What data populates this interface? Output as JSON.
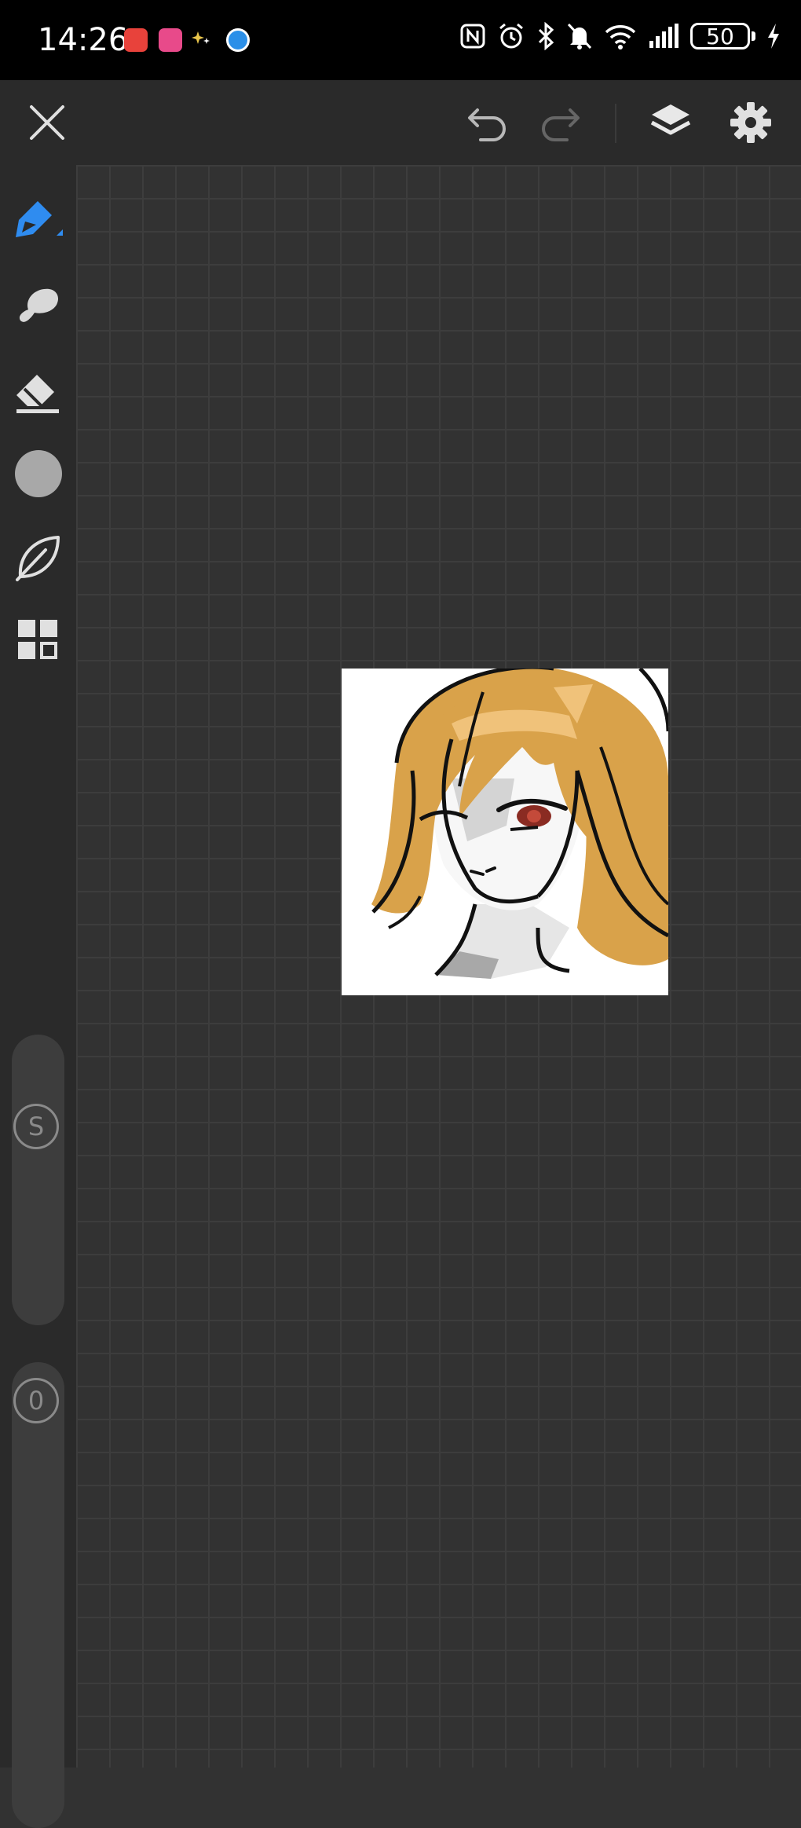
{
  "status_bar": {
    "time": "14:26",
    "battery_level": "50",
    "icons": [
      "nfc-icon",
      "alarm-icon",
      "bluetooth-icon",
      "mute-icon",
      "wifi-icon",
      "signal-icon",
      "battery-icon",
      "charging-icon"
    ],
    "notification_icons": [
      "huawei-app-icon",
      "pink-app-icon",
      "sparkle-icon",
      "browser-icon"
    ]
  },
  "toolbar": {
    "icons": [
      "close-icon",
      "undo-icon",
      "redo-icon",
      "layers-icon",
      "settings-icon"
    ]
  },
  "tools": [
    {
      "name": "pen-tool",
      "icon": "pen-icon",
      "active": true
    },
    {
      "name": "smudge-tool",
      "icon": "smudge-icon"
    },
    {
      "name": "eraser-tool",
      "icon": "eraser-icon"
    },
    {
      "name": "color-tool",
      "icon": "color-swatch-icon",
      "color": "#a8a8a8"
    },
    {
      "name": "shape-tool",
      "icon": "leaf-icon"
    },
    {
      "name": "more-tool",
      "icon": "grid-icon"
    }
  ],
  "sliders": {
    "size_label": "S",
    "opacity_label": "0"
  },
  "colors": {
    "accent": "#2f8cf0",
    "toolbar_bg": "#2a2a2a",
    "canvas_bg": "#323232",
    "hair": "#d9a24a"
  }
}
